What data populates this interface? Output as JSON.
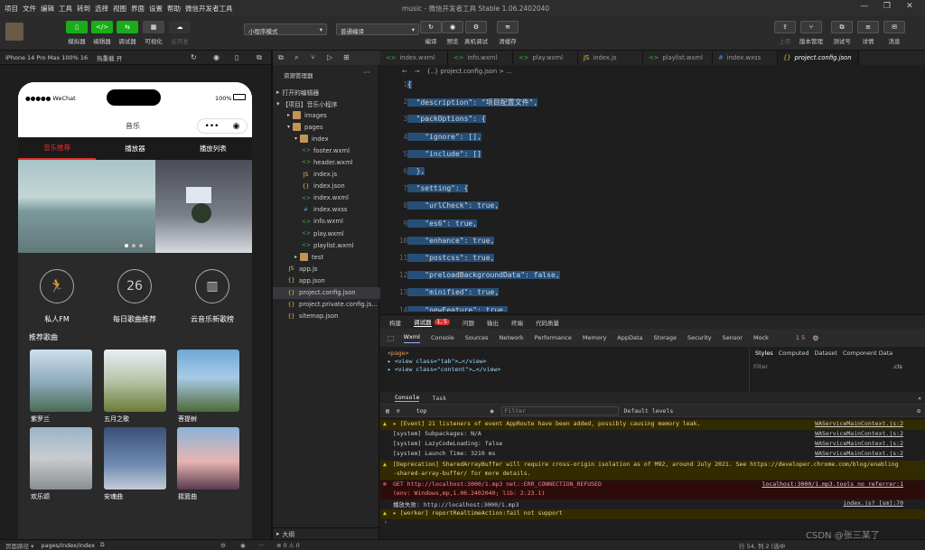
{
  "menu": {
    "items": [
      "项目",
      "文件",
      "编辑",
      "工具",
      "转到",
      "选择",
      "视图",
      "界面",
      "设置",
      "帮助",
      "微信开发者工具"
    ],
    "title": "music - 微信开发者工具 Stable 1.06.2402040"
  },
  "toolbar": {
    "left_buttons": [
      {
        "label": "模拟器",
        "icon": "phone-icon"
      },
      {
        "label": "编辑器",
        "icon": "code-icon"
      },
      {
        "label": "调试器",
        "icon": "debug-icon"
      },
      {
        "label": "可视化",
        "icon": "visual-icon"
      },
      {
        "label": "云开发",
        "icon": "cloud-icon"
      }
    ],
    "mode_select": "小程序模式",
    "compile_select": "普通编译",
    "mid_buttons": [
      "编译",
      "预览",
      "真机调试",
      "清缓存"
    ],
    "right_buttons": [
      "上传",
      "版本管理",
      "测试号",
      "详情",
      "消息"
    ]
  },
  "simulator": {
    "device": "iPhone 14 Pro Max 100% 16",
    "hotreload": "热重载 开"
  },
  "phone": {
    "carrier": "●●●●● WeChat",
    "battery": "100%",
    "nav_title": "音乐",
    "tabs": [
      "音乐推荐",
      "播放器",
      "播放列表"
    ],
    "circle_items": [
      {
        "label": "私人FM",
        "icon": "run-icon",
        "text": "🏃"
      },
      {
        "label": "每日歌曲推荐",
        "icon": "calendar-day-icon",
        "text": "26"
      },
      {
        "label": "云音乐新歌榜",
        "icon": "chart-icon",
        "text": "▥"
      }
    ],
    "section_title": "推荐歌曲",
    "songs": [
      "紫罗兰",
      "五月之歌",
      "菩提树",
      "欢乐颂",
      "安魂曲",
      "摇篮曲"
    ]
  },
  "explorer": {
    "title": "资源管理器",
    "open_editors": "打开的编辑器",
    "project": "【项目】音乐小程序",
    "tree": [
      {
        "name": "images",
        "depth": 1,
        "type": "folder"
      },
      {
        "name": "pages",
        "depth": 1,
        "type": "folder"
      },
      {
        "name": "index",
        "depth": 2,
        "type": "folder"
      },
      {
        "name": "footer.wxml",
        "depth": 3,
        "type": "wxml"
      },
      {
        "name": "header.wxml",
        "depth": 3,
        "type": "wxml"
      },
      {
        "name": "index.js",
        "depth": 3,
        "type": "js"
      },
      {
        "name": "index.json",
        "depth": 3,
        "type": "json"
      },
      {
        "name": "index.wxml",
        "depth": 3,
        "type": "wxml"
      },
      {
        "name": "index.wxss",
        "depth": 3,
        "type": "wxss"
      },
      {
        "name": "info.wxml",
        "depth": 3,
        "type": "wxml"
      },
      {
        "name": "play.wxml",
        "depth": 3,
        "type": "wxml"
      },
      {
        "name": "playlist.wxml",
        "depth": 3,
        "type": "wxml"
      },
      {
        "name": "test",
        "depth": 2,
        "type": "folder"
      },
      {
        "name": "app.js",
        "depth": 1,
        "type": "js"
      },
      {
        "name": "app.json",
        "depth": 1,
        "type": "json"
      },
      {
        "name": "project.config.json",
        "depth": 1,
        "type": "json"
      },
      {
        "name": "project.private.config.js...",
        "depth": 1,
        "type": "json"
      },
      {
        "name": "sitemap.json",
        "depth": 1,
        "type": "json"
      }
    ],
    "outline": "大纲"
  },
  "editor": {
    "tabs": [
      "index.wxml",
      "info.wxml",
      "play.wxml",
      "index.js",
      "playlist.wxml",
      "index.wxss",
      "project.config.json"
    ],
    "breadcrumb": "{..} project.config.json > ...",
    "lines": [
      {
        "n": "1",
        "t": "{"
      },
      {
        "n": "2",
        "t": "  \"description\": \"项目配置文件\","
      },
      {
        "n": "3",
        "t": "  \"packOptions\": {"
      },
      {
        "n": "4",
        "t": "    \"ignore\": [],"
      },
      {
        "n": "5",
        "t": "    \"include\": []"
      },
      {
        "n": "6",
        "t": "  },"
      },
      {
        "n": "7",
        "t": "  \"setting\": {"
      },
      {
        "n": "8",
        "t": "    \"urlCheck\": true,"
      },
      {
        "n": "9",
        "t": "    \"es6\": true,"
      },
      {
        "n": "10",
        "t": "    \"enhance\": true,"
      },
      {
        "n": "11",
        "t": "    \"postcss\": true,"
      },
      {
        "n": "12",
        "t": "    \"preloadBackgroundData\": false,"
      },
      {
        "n": "13",
        "t": "    \"minified\": true,"
      },
      {
        "n": "14",
        "t": "    \"newFeature\": true,"
      }
    ]
  },
  "devtools": {
    "top_tabs": [
      "构建",
      "调试器",
      "问题",
      "输出",
      "终端",
      "代码质量"
    ],
    "badge": "1, 5",
    "panel_tabs": [
      "Wxml",
      "Console",
      "Sources",
      "Network",
      "Performance",
      "Memory",
      "AppData",
      "Storage",
      "Security",
      "Sensor",
      "Mock"
    ],
    "counts": "1  5",
    "wxml_lines": [
      "<page>",
      "▸ <view class=\"tab\">…</view>",
      "▸ <view class=\"content\">…</view>"
    ],
    "style_tabs": [
      "Styles",
      "Computed",
      "Dataset",
      "Component Data"
    ],
    "filter": "Filter",
    "cls": ".cls"
  },
  "console": {
    "tabs": [
      "Console",
      "Task"
    ],
    "context": "top",
    "filter_placeholder": "Filter",
    "levels": "Default levels",
    "lines": [
      {
        "kind": "warn",
        "text": "▸ [Event] 21 listeners of event AppRoute have been added, possibly causing memory leak.",
        "src": "WAServiceMainContext.js:2"
      },
      {
        "kind": "info",
        "text": "[system] Subpackages: N/A",
        "src": "WAServiceMainContext.js:2"
      },
      {
        "kind": "info",
        "text": "[system] LazyCodeLoading: false",
        "src": "WAServiceMainContext.js:2"
      },
      {
        "kind": "info",
        "text": "[system] Launch Time: 3210 ms",
        "src": "WAServiceMainContext.js:2"
      },
      {
        "kind": "warn",
        "text": "[Deprecation] SharedArrayBuffer will require cross-origin isolation as of M92, around July 2021. See https://developer.chrome.com/blog/enabling",
        "src": ""
      },
      {
        "kind": "warn2",
        "text": "-shared-array-buffer/ for more details.",
        "src": ""
      },
      {
        "kind": "err",
        "text": "GET http://localhost:3000/1.mp3 net::ERR_CONNECTION_REFUSED",
        "src": "localhost:3000/1.mp3.tools_no_referrer:1"
      },
      {
        "kind": "err2",
        "text": "(env: Windows,mp,1.06.2402040; lib: 2.23.1)",
        "src": ""
      },
      {
        "kind": "info",
        "text": "播放失败: http://localhost:3000/1.mp3",
        "src": "index.js? [sm]:70"
      },
      {
        "kind": "warn",
        "text": "▸ [worker] reportRealtimeAction:fail not support",
        "src": ""
      }
    ]
  },
  "footer": {
    "left": "页面路径 ▾",
    "path": "pages/index/index",
    "errors": "⊗ 0 ⚠ 0",
    "position": "行 54, 列 2 (选中",
    "watermark": "CSDN @张三某了"
  }
}
